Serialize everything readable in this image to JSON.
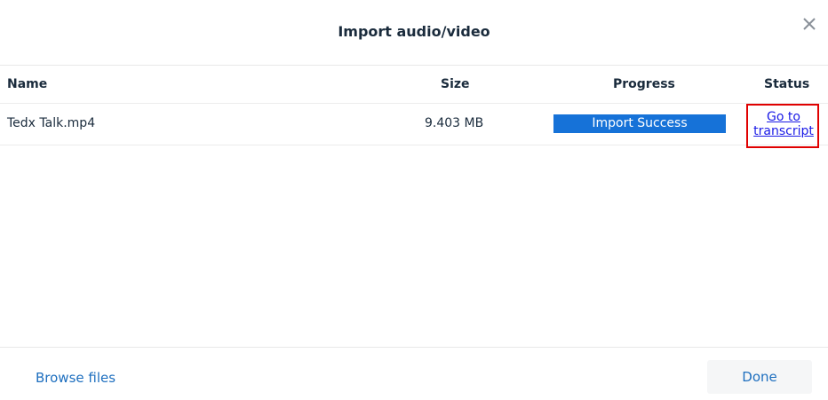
{
  "dialog": {
    "title": "Import audio/video",
    "close_icon": "close-icon"
  },
  "table": {
    "headers": {
      "name": "Name",
      "size": "Size",
      "progress": "Progress",
      "status": "Status"
    },
    "rows": [
      {
        "name": "Tedx Talk.mp4",
        "size": "9.403 MB",
        "progress_label": "Import Success",
        "progress_fraction": 1.0,
        "status_link_line1": "Go to",
        "status_link_line2": "transcript"
      }
    ]
  },
  "footer": {
    "browse_label": "Browse files",
    "done_label": "Done"
  },
  "colors": {
    "progress_fill": "#1672d8",
    "link": "#1a1ae6",
    "highlight_border": "#e00000",
    "action_text": "#1e6fbf"
  }
}
